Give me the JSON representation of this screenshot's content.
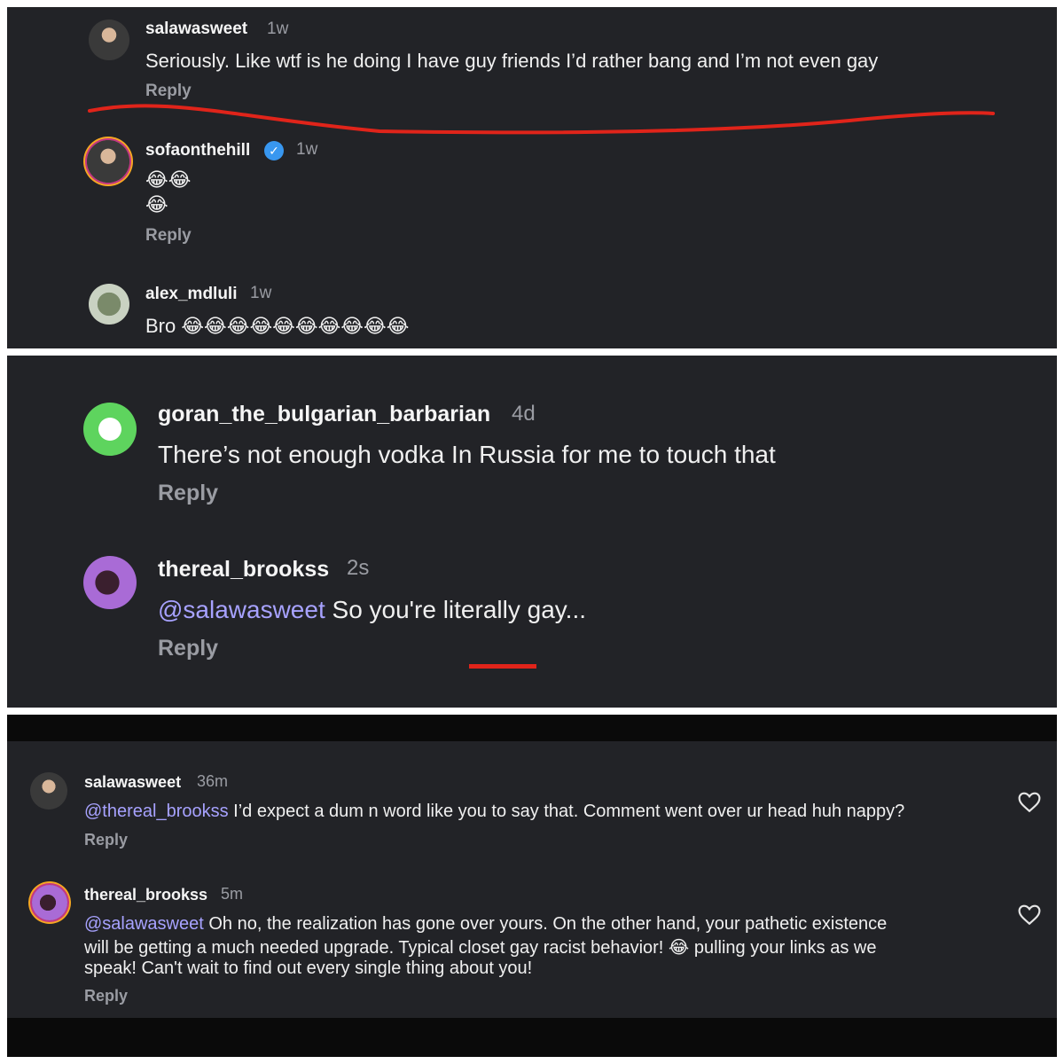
{
  "panel1": {
    "c1": {
      "username": "salawasweet",
      "time": "1w",
      "text": "Seriously. Like wtf is he doing I have guy friends I’d rather bang and I’m not even gay",
      "reply": "Reply"
    },
    "c2": {
      "username": "sofaonthehill",
      "time": "1w",
      "line1": "😂😂",
      "line2": "😂",
      "reply": "Reply"
    },
    "c3": {
      "username": "alex_mdluli",
      "time": "1w",
      "text": "Bro 😂😂😂😂😂😂😂😂😂😂"
    }
  },
  "panel2": {
    "c1": {
      "username": "goran_the_bulgarian_barbarian",
      "time": "4d",
      "text": "There’s not enough vodka In Russia for me to touch that",
      "reply": "Reply"
    },
    "c2": {
      "username": "thereal_brookss",
      "time": "2s",
      "mention": "@salawasweet",
      "text": " So you're literally gay...",
      "reply": "Reply"
    }
  },
  "panel3": {
    "c1": {
      "username": "salawasweet",
      "time": "36m",
      "mention": "@thereal_brookss",
      "text": " I’d expect a dum n word like you to say that. Comment went over ur head huh nappy?",
      "reply": "Reply"
    },
    "c2": {
      "username": "thereal_brookss",
      "time": "5m",
      "mention": "@salawasweet",
      "text1": " Oh no, the realization has gone over yours. On the other hand, your pathetic existence",
      "text2": "will be getting a much needed upgrade. Typical closet gay racist behavior! 😂 pulling your links as we",
      "text3": "speak! Can't wait to find out every single thing about you!",
      "reply": "Reply"
    }
  },
  "colors": {
    "background": "#222327",
    "mention": "#a7a2ff",
    "annotation_red": "#e0241a",
    "verified": "#3897f0"
  },
  "icons": [
    "verified-badge-icon",
    "heart-icon"
  ]
}
